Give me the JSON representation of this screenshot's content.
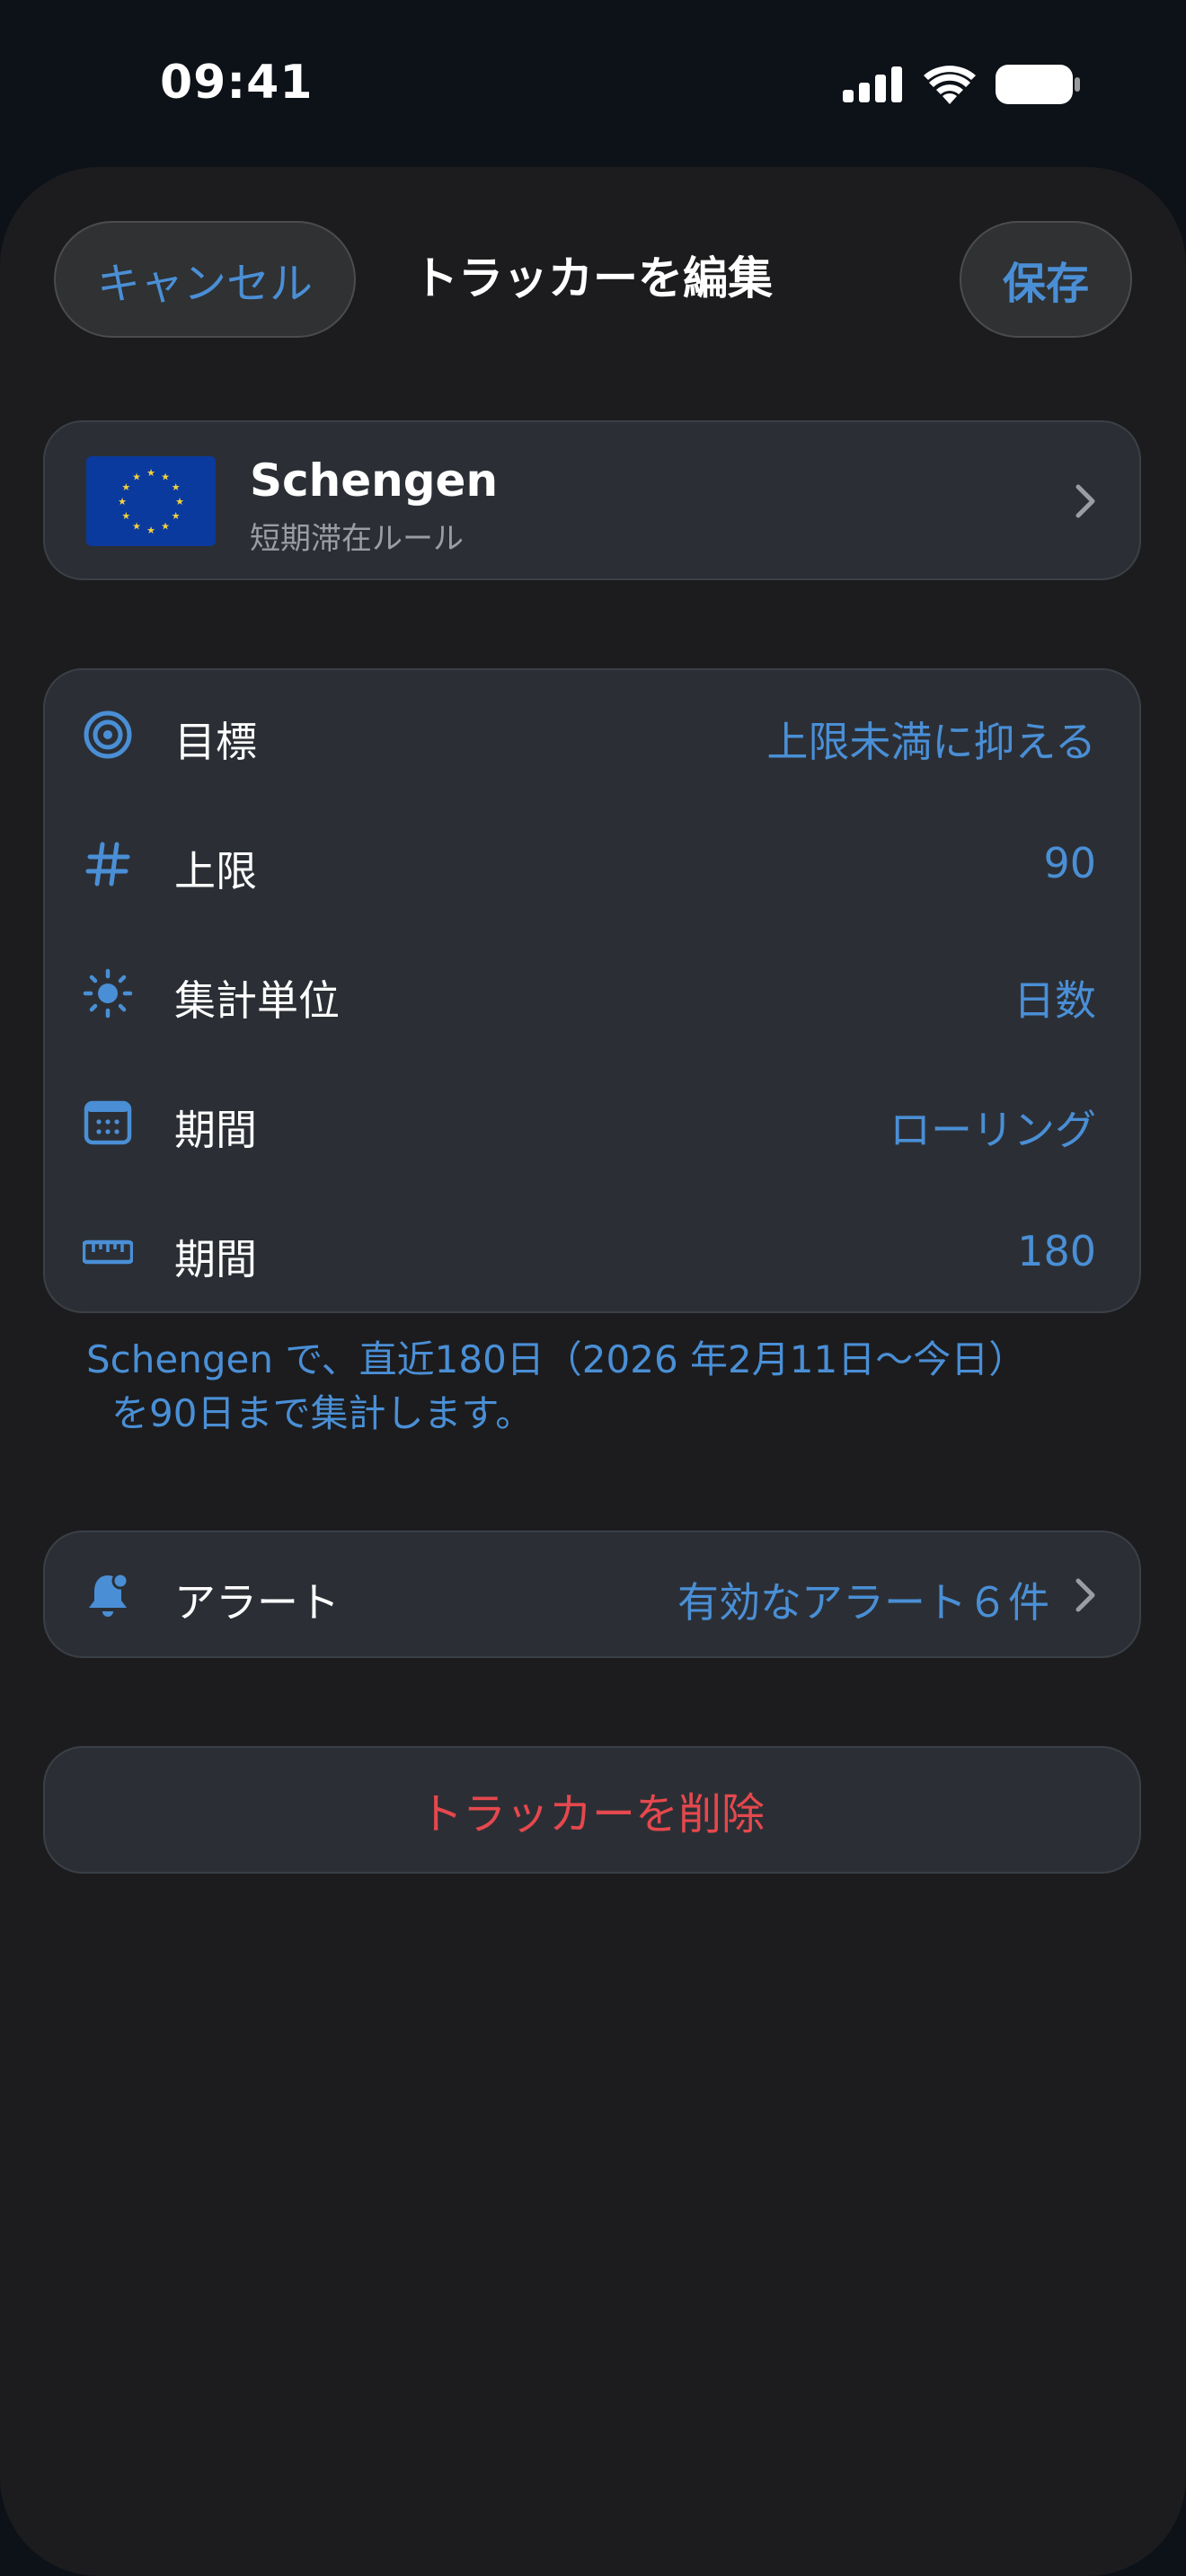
{
  "status_bar": {
    "time": "09:41"
  },
  "nav": {
    "cancel_label": "キャンセル",
    "title": "トラッカーを編集",
    "save_label": "保存"
  },
  "rule": {
    "name": "Schengen",
    "subtitle": "短期滞在ルール",
    "flag_icon": "eu-flag-icon"
  },
  "settings": [
    {
      "icon": "target-icon",
      "label": "目標",
      "value": "上限未満に抑える"
    },
    {
      "icon": "hash-icon",
      "label": "上限",
      "value": "90"
    },
    {
      "icon": "sun-icon",
      "label": "集計単位",
      "value": "日数"
    },
    {
      "icon": "calendar-icon",
      "label": "期間",
      "value": "ローリング"
    },
    {
      "icon": "ruler-icon",
      "label": "期間",
      "value": "180"
    }
  ],
  "summary": {
    "line1": "Schengen で、直近180日（2026 年2月11日〜今日）",
    "line2": "を90日まで集計します。"
  },
  "alerts": {
    "icon": "bell-icon",
    "label": "アラート",
    "value": "有効なアラート６件"
  },
  "delete": {
    "label": "トラッカーを削除"
  },
  "colors": {
    "accent": "#4a8fd6",
    "destructive": "#e5484d",
    "card": "#2b2f35",
    "sheet": "#1c1c1e"
  }
}
